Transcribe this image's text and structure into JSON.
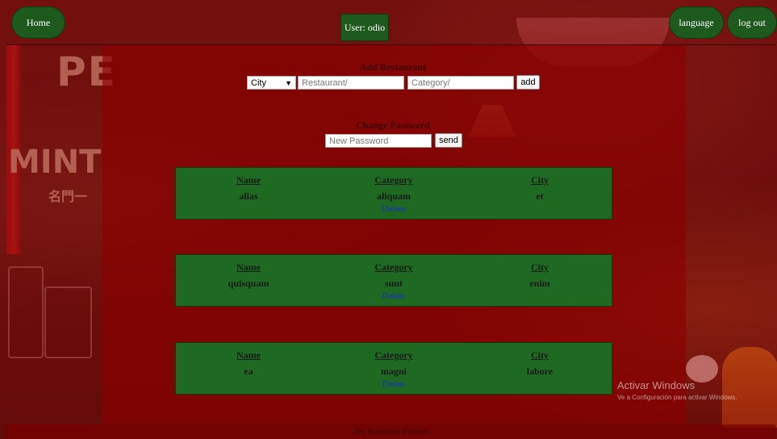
{
  "nav": {
    "home_label": "Home",
    "user_label": "User: odio",
    "language_label": "language",
    "logout_label": "log out"
  },
  "add_restaurant": {
    "title": "Add Restaurant",
    "city_select_value": "City",
    "restaurant_placeholder": "Restaurant/",
    "category_placeholder": "Category/",
    "add_button": "add"
  },
  "change_password": {
    "title": "Change Password",
    "password_placeholder": "New Password",
    "send_button": "send"
  },
  "restaurants": {
    "headers": {
      "name": "Name",
      "category": "Category",
      "city": "City"
    },
    "delete_label": "Delete",
    "items": [
      {
        "name": "alias",
        "category": "aliquam",
        "city": "et"
      },
      {
        "name": "quisquam",
        "category": "sunt",
        "city": "enim"
      },
      {
        "name": "ea",
        "category": "magni",
        "city": "labore"
      }
    ]
  },
  "watermark": {
    "line1": "Activar Windows",
    "line2": "Ve a Configuración para activar Windows."
  },
  "footer": {
    "text": "Jim Banderas Friends"
  },
  "colors": {
    "nav_pill": "#1e5a1e",
    "card_bg": "#1f6a22",
    "overlay": "#960a0a",
    "link": "#1a2ad8"
  }
}
